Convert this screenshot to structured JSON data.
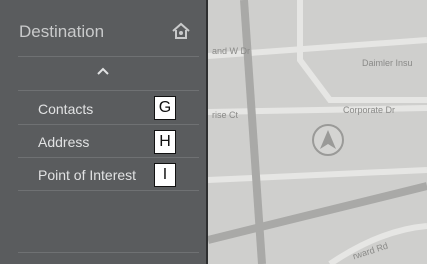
{
  "panel": {
    "title": "Destination",
    "home_icon": "home-location-icon",
    "collapse_icon": "chevron-up-icon",
    "items": [
      {
        "label": "Contacts",
        "callout": "G"
      },
      {
        "label": "Address",
        "callout": "H"
      },
      {
        "label": "Point of Interest",
        "callout": "I"
      }
    ]
  },
  "map": {
    "road_labels": [
      "and W Dr",
      "Daimler Insu",
      "Corporate Dr",
      "rise Ct",
      "rward Rd"
    ],
    "position_icon": "north-arrow-position-icon"
  },
  "colors": {
    "panel_bg": "#5a5c5e",
    "map_bg": "#cfcfcd",
    "road": "#e6e6e4",
    "highway": "#a9a9a7"
  }
}
